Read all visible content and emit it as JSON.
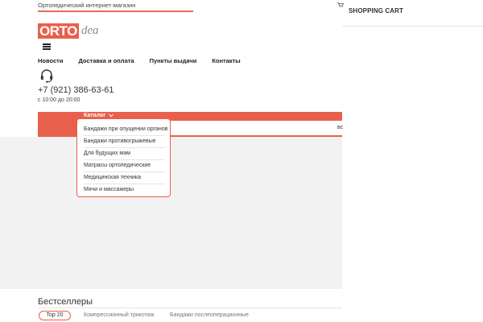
{
  "topbar": {
    "tagline": "Ортопедический интернет-магазин"
  },
  "cart": {
    "title": "SHOPPING CART",
    "icon": "cart-icon"
  },
  "logo": {
    "box_text": "ORTO",
    "script_text": "dea"
  },
  "nav": {
    "items": [
      "Новости",
      "Доставка и оплата",
      "Пункты выдачи",
      "Контакты"
    ]
  },
  "contact": {
    "icon": "headset-icon",
    "phone": "+7 (921) 386-63-61",
    "hours": "с 10:00 до 20:00"
  },
  "catalog": {
    "label": "Каталог",
    "items": [
      "Бандажи при опущении органов",
      "Бандажи противогрыжевые",
      "Для будущих мам",
      "Матрасы ортопедические",
      "Медицинская техника",
      "Мячи и массажеры"
    ],
    "right_fragment": "вс"
  },
  "bestsellers": {
    "title": "Бестселлеры",
    "tabs": [
      "Top 20",
      "Компрессионный трикотаж",
      "Бандажи послеоперационные"
    ]
  },
  "colors": {
    "accent": "#e8604c",
    "background": "#ffffff",
    "panel": "#f2f2f2"
  }
}
